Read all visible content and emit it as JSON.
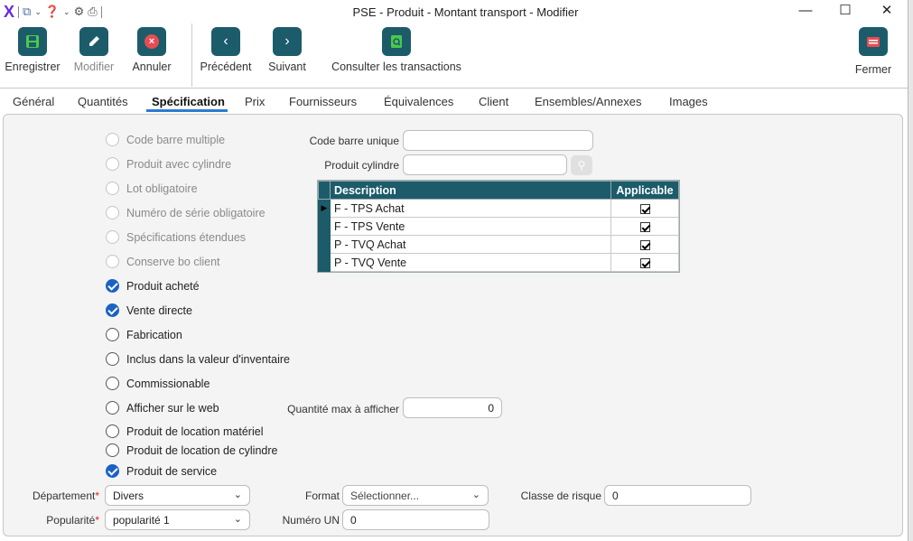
{
  "window": {
    "title": "PSE - Produit - Montant transport - Modifier",
    "logo": "X"
  },
  "toolbar": {
    "save": "Enregistrer",
    "modify": "Modifier",
    "cancel": "Annuler",
    "previous": "Précédent",
    "next": "Suivant",
    "transactions": "Consulter les transactions",
    "close": "Fermer"
  },
  "tabs": [
    "Général",
    "Quantités",
    "Spécification",
    "Prix",
    "Fournisseurs",
    "Équivalences",
    "Client",
    "Ensembles/Annexes",
    "Images"
  ],
  "active_tab": "Spécification",
  "options": [
    {
      "label": "Code barre multiple",
      "checked": false,
      "disabled": true
    },
    {
      "label": "Produit avec cylindre",
      "checked": false,
      "disabled": true
    },
    {
      "label": "Lot obligatoire",
      "checked": false,
      "disabled": true
    },
    {
      "label": "Numéro de série obligatoire",
      "checked": false,
      "disabled": true
    },
    {
      "label": "Spécifications étendues",
      "checked": false,
      "disabled": true
    },
    {
      "label": "Conserve bo client",
      "checked": false,
      "disabled": true
    },
    {
      "label": "Produit acheté",
      "checked": true,
      "disabled": false
    },
    {
      "label": "Vente directe",
      "checked": true,
      "disabled": false
    },
    {
      "label": "Fabrication",
      "checked": false,
      "disabled": false
    },
    {
      "label": "Inclus dans la valeur d'inventaire",
      "checked": false,
      "disabled": false
    },
    {
      "label": "Commissionable",
      "checked": false,
      "disabled": false
    },
    {
      "label": "Afficher sur le web",
      "checked": false,
      "disabled": false
    },
    {
      "label": "Produit de location matériel",
      "checked": false,
      "disabled": false
    },
    {
      "label": "Produit de location de cylindre",
      "checked": false,
      "disabled": false
    },
    {
      "label": "Produit de service",
      "checked": true,
      "disabled": false
    }
  ],
  "fields": {
    "code_barre_unique": {
      "label": "Code barre unique",
      "value": ""
    },
    "produit_cylindre": {
      "label": "Produit cylindre",
      "value": ""
    },
    "quantite_max": {
      "label": "Quantité max à afficher",
      "value": "0"
    },
    "departement": {
      "label": "Département",
      "value": "Divers"
    },
    "popularite": {
      "label": "Popularité",
      "value": "popularité 1"
    },
    "format": {
      "label": "Format",
      "value": "Sélectionner..."
    },
    "numero_un": {
      "label": "Numéro UN",
      "value": "0"
    },
    "classe_risque": {
      "label": "Classe de risque",
      "value": "0"
    }
  },
  "tax_grid": {
    "headers": [
      "Description",
      "Applicable"
    ],
    "rows": [
      {
        "description": "F - TPS Achat",
        "applicable": true,
        "current": true
      },
      {
        "description": "F - TPS Vente",
        "applicable": true,
        "current": false
      },
      {
        "description": "P - TVQ Achat",
        "applicable": true,
        "current": false
      },
      {
        "description": "P - TVQ Vente",
        "applicable": true,
        "current": false
      }
    ]
  },
  "colors": {
    "accent": "#1c5c6a",
    "tab_underline": "#2b7cd3",
    "check": "#1a62c4",
    "logo": "#6d2ad6"
  }
}
